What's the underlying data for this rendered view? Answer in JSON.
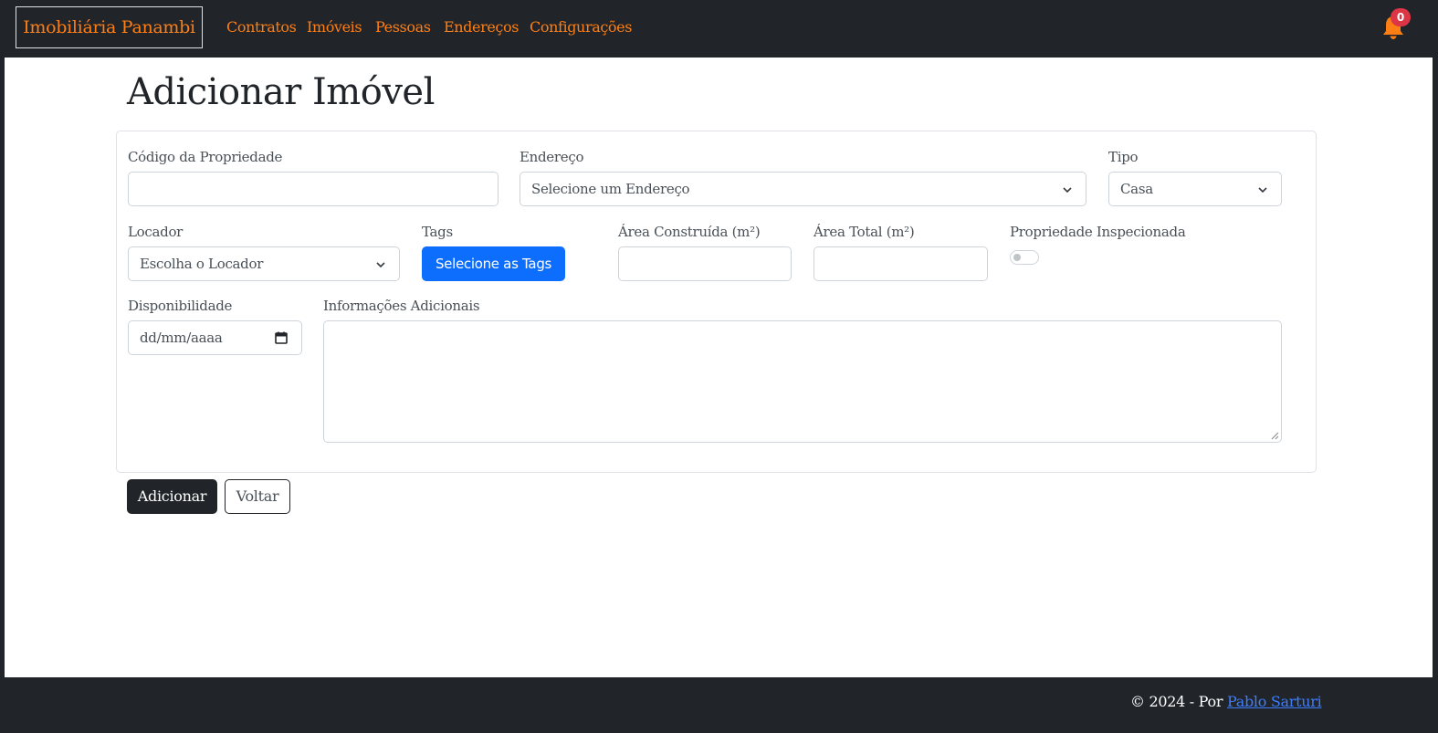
{
  "navbar": {
    "brand": "Imobiliária Panambi",
    "links": [
      "Contratos",
      "Imóveis",
      "Pessoas",
      "Endereços",
      "Configurações"
    ],
    "notification_count": "0",
    "accent_color": "#fd7e14"
  },
  "page": {
    "title": "Adicionar Imóvel"
  },
  "form": {
    "codigo": {
      "label": "Código da Propriedade",
      "value": ""
    },
    "endereco": {
      "label": "Endereço",
      "value": "Selecione um Endereço"
    },
    "tipo": {
      "label": "Tipo",
      "value": "Casa"
    },
    "locador": {
      "label": "Locador",
      "value": "Escolha o Locador"
    },
    "tags": {
      "label": "Tags",
      "button": "Selecione as Tags"
    },
    "area_construida": {
      "label": "Área Construída (m²)",
      "value": ""
    },
    "area_total": {
      "label": "Área Total (m²)",
      "value": ""
    },
    "inspecionada": {
      "label": "Propriedade Inspecionada",
      "checked": false
    },
    "disponibilidade": {
      "label": "Disponibilidade",
      "placeholder": "dd/mm/aaaa"
    },
    "informacoes": {
      "label": "Informações Adicionais",
      "value": ""
    }
  },
  "actions": {
    "submit": "Adicionar",
    "back": "Voltar"
  },
  "footer": {
    "text": "© 2024 - Por",
    "author": "Pablo Sarturi"
  },
  "icons": {
    "bell": "bell-icon",
    "chevron": "chevron-down-icon",
    "calendar": "calendar-icon"
  }
}
